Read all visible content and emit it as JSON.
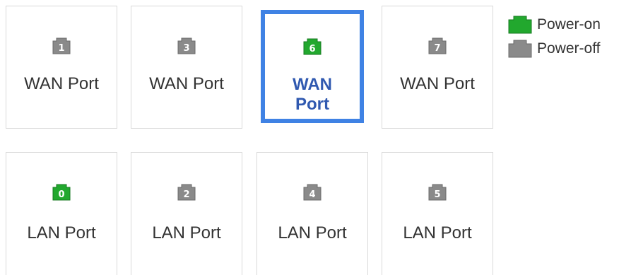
{
  "colors": {
    "power_on": "#22a82e",
    "power_off": "#8a8a8a",
    "selected_border": "#3f82e4",
    "selected_text": "#3059b0"
  },
  "wan_ports": [
    {
      "number": "1",
      "label": "WAN Port",
      "power": "off",
      "selected": false
    },
    {
      "number": "3",
      "label": "WAN Port",
      "power": "off",
      "selected": false
    },
    {
      "number": "6",
      "label": "WAN Port",
      "power": "on",
      "selected": true
    },
    {
      "number": "7",
      "label": "WAN Port",
      "power": "off",
      "selected": false
    }
  ],
  "lan_ports": [
    {
      "number": "0",
      "label": "LAN Port",
      "power": "on",
      "selected": false
    },
    {
      "number": "2",
      "label": "LAN Port",
      "power": "off",
      "selected": false
    },
    {
      "number": "4",
      "label": "LAN Port",
      "power": "off",
      "selected": false
    },
    {
      "number": "5",
      "label": "LAN Port",
      "power": "off",
      "selected": false
    }
  ],
  "legend": {
    "power_on": {
      "label": "Power-on",
      "icon": "ethernet-port-icon"
    },
    "power_off": {
      "label": "Power-off",
      "icon": "ethernet-port-icon"
    }
  }
}
